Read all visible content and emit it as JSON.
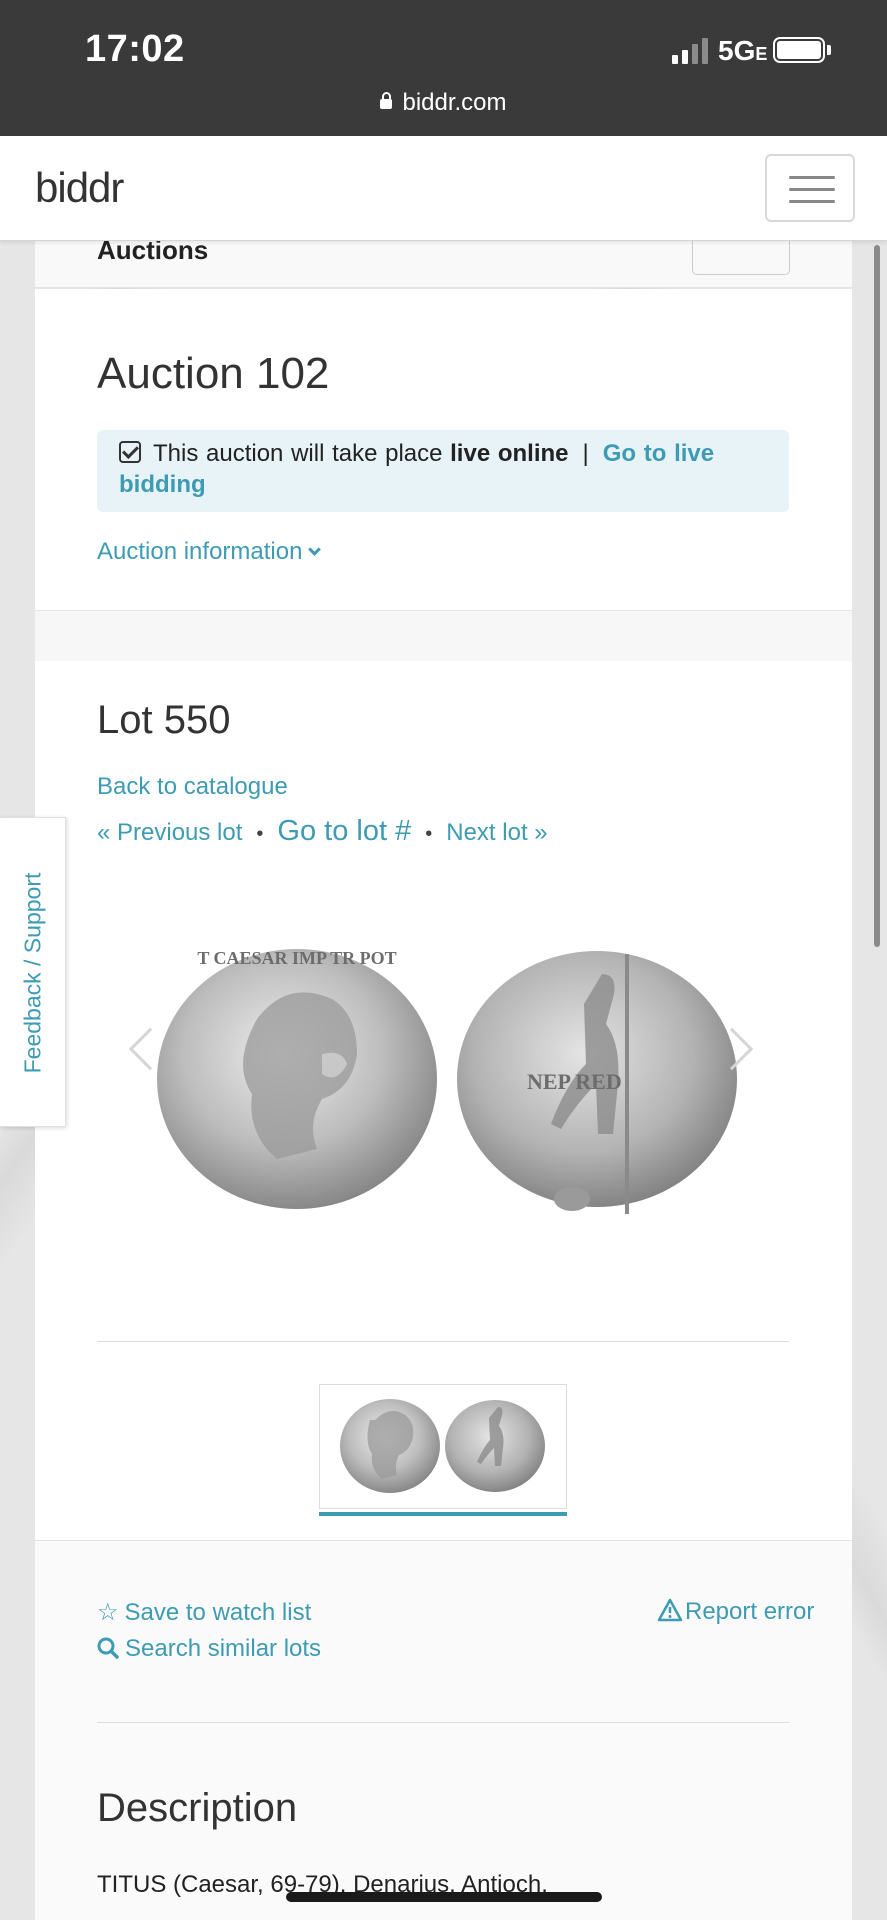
{
  "status_bar": {
    "time": "17:02",
    "network": "5G",
    "network_suffix": "E",
    "url": "biddr.com"
  },
  "header": {
    "logo": "biddr"
  },
  "strip": {
    "title": "Auctions"
  },
  "auction": {
    "title": "Auction 102",
    "notice_prefix": "This auction will take place",
    "notice_bold": "live online",
    "notice_sep": "|",
    "live_link": "Go to live bidding",
    "info_link": "Auction information"
  },
  "lot": {
    "title": "Lot 550",
    "back_link": "Back to catalogue",
    "prev_link": "« Previous lot",
    "goto_link": "Go to lot #",
    "next_link": "Next lot »",
    "dot": "•",
    "coin_obverse_legend": "T CAESAR IMP TR POT",
    "coin_reverse_legend": "NEP RED"
  },
  "actions": {
    "save_watch": "Save to watch list",
    "search_similar": "Search similar lots",
    "report_error": "Report error"
  },
  "description": {
    "heading": "Description",
    "text": "TITUS (Caesar, 69-79). Denarius. Antioch."
  },
  "feedback_tab": "Feedback / Support",
  "colors": {
    "accent": "#3d9bb3",
    "alert_bg": "#e7f3f6",
    "status_bar": "#3a3a3a"
  }
}
